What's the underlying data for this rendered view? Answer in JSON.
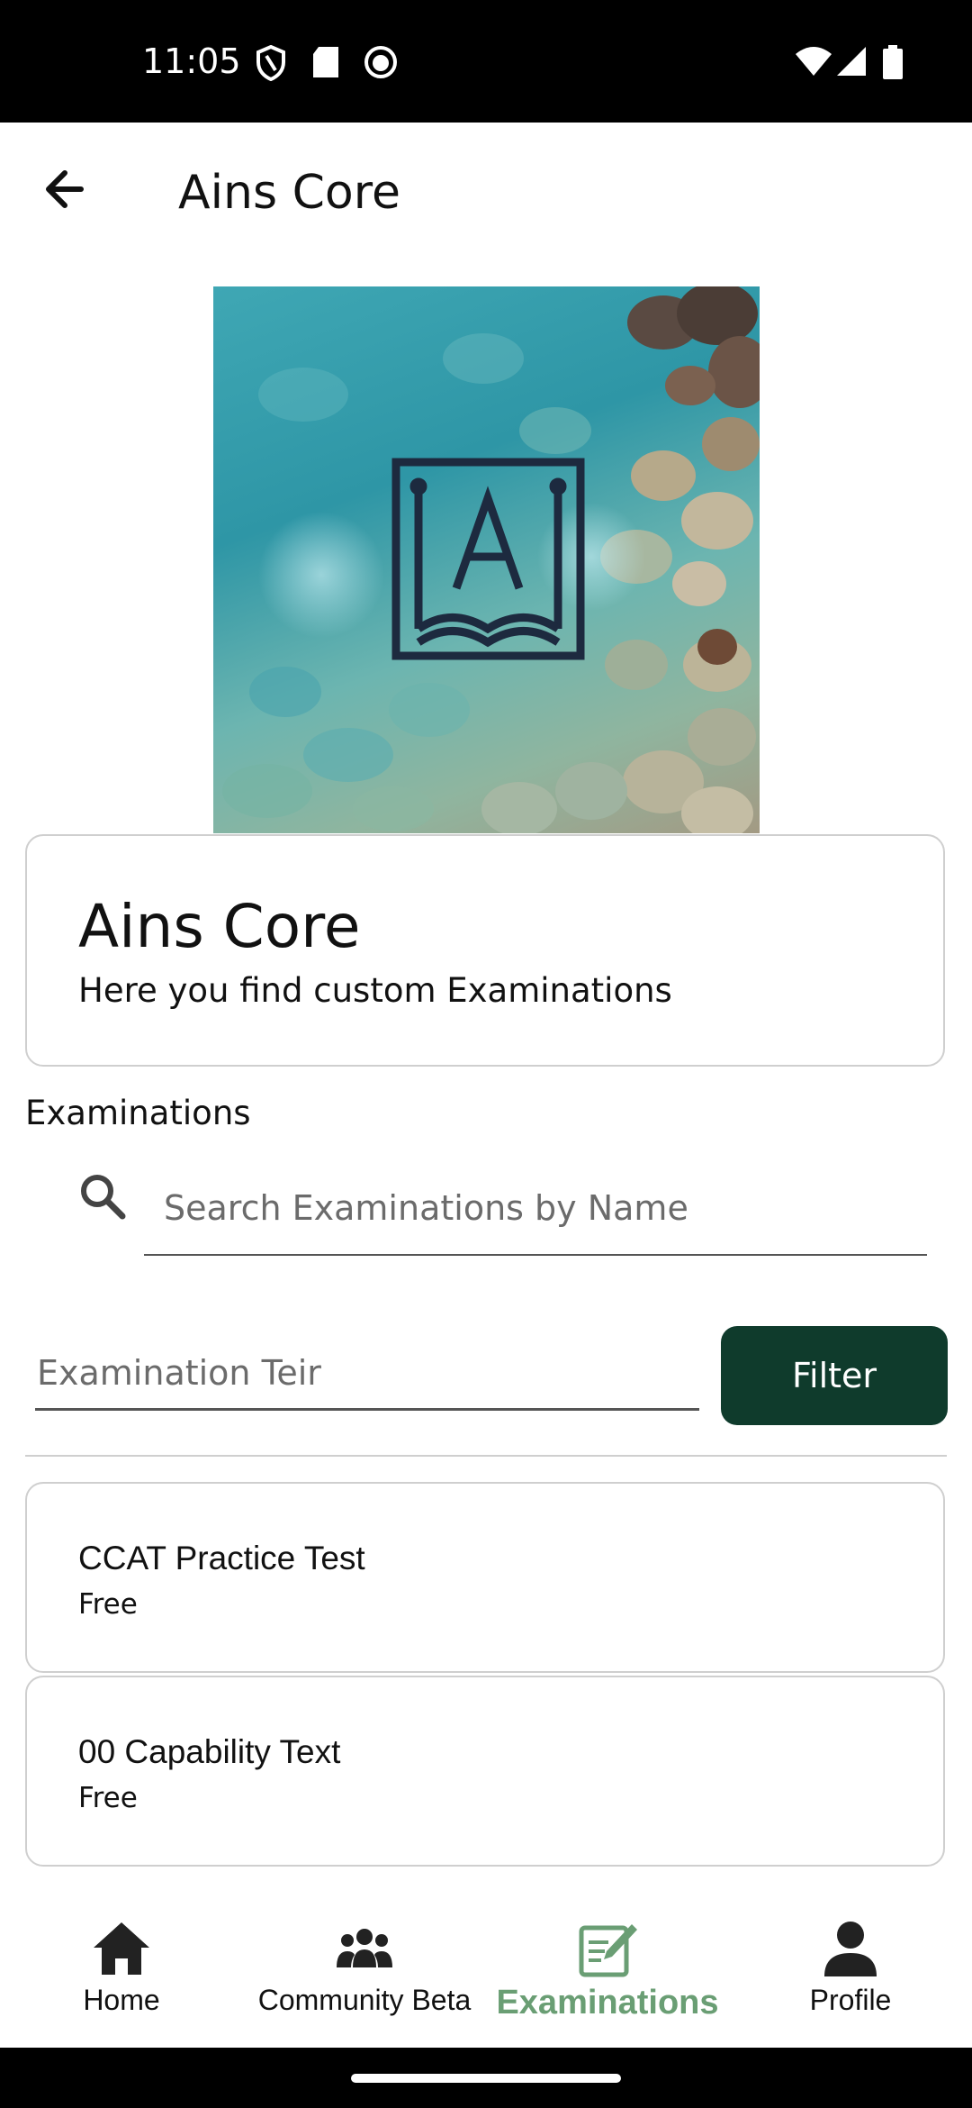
{
  "status_bar": {
    "time": "11:05"
  },
  "app_bar": {
    "title": "Ains Core"
  },
  "header_card": {
    "title": "Ains Core",
    "subtitle": "Here you find custom Examinations"
  },
  "section": {
    "label": "Examinations"
  },
  "search": {
    "placeholder": "Search Examinations by Name"
  },
  "filter": {
    "tier_placeholder": "Examination Teir",
    "button_label": "Filter"
  },
  "exams": [
    {
      "title": "CCAT Practice Test",
      "price": "Free"
    },
    {
      "title": "00 Capability Text",
      "price": "Free"
    }
  ],
  "bottom_nav": {
    "items": [
      {
        "label": "Home",
        "icon": "home-icon"
      },
      {
        "label": "Community Beta",
        "icon": "group-icon"
      },
      {
        "label": "Examinations",
        "icon": "exam-edit-icon",
        "active": true
      },
      {
        "label": "Profile",
        "icon": "person-icon"
      }
    ]
  },
  "colors": {
    "accent": "#0f3b2c",
    "nav_active": "#6a9e74"
  }
}
